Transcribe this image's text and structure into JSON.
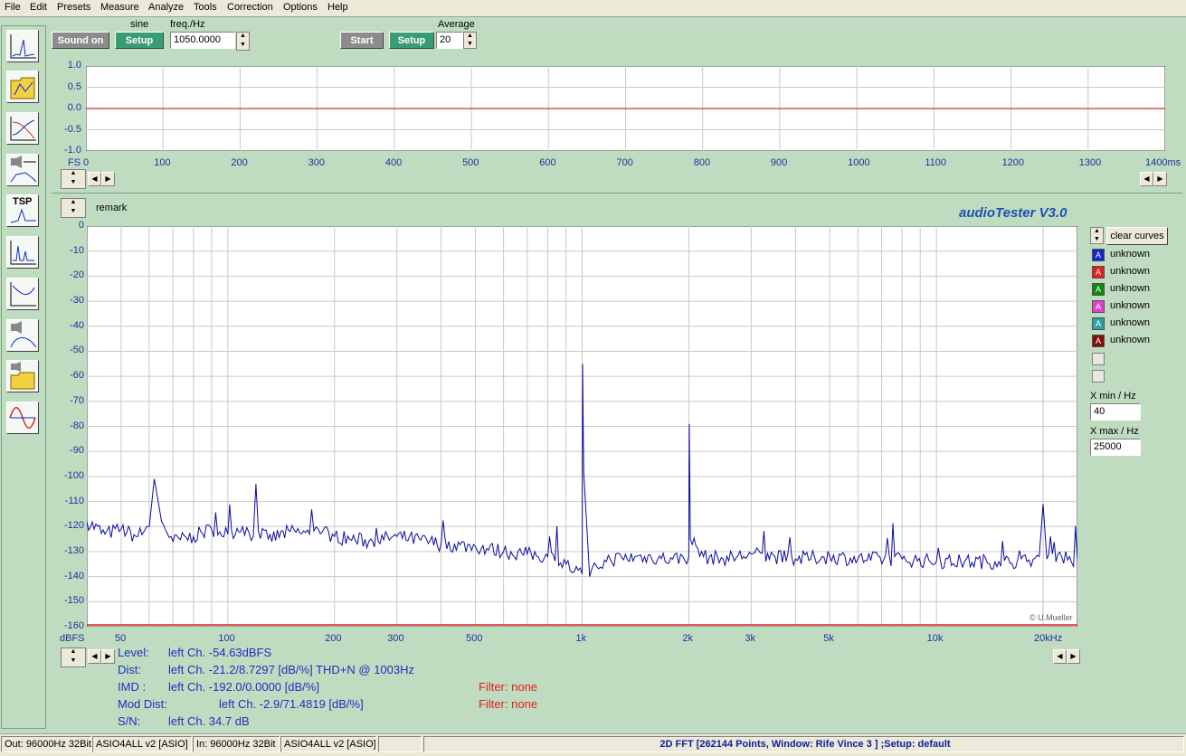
{
  "menu": [
    "File",
    "Edit",
    "Presets",
    "Measure",
    "Analyze",
    "Tools",
    "Correction",
    "Options",
    "Help"
  ],
  "toolbar": {
    "sound_on_label": "Sound on",
    "sine_label": "sine",
    "generator_setup_label": "Setup",
    "freq_label": "freq./Hz",
    "freq_value": "1050.0000",
    "start_label": "Start",
    "analyzer_setup_label": "Setup",
    "average_label": "Average",
    "average_value": "20"
  },
  "sidebar": {
    "tools": [
      "scope-fft-icon",
      "open-folder-icon",
      "bode-plot-icon",
      "speaker-response-icon",
      "tsp-icon",
      "fft-spectrum-icon",
      "frequency-response-icon",
      "speaker-rolloff-icon",
      "open-speaker-file-icon",
      "sine-wave-icon"
    ],
    "tsp_label": "TSP"
  },
  "scope": {
    "y_ticks": [
      "1.0",
      "0.5",
      "0.0",
      "-0.5",
      "-1.0"
    ],
    "x_prefix": "FS",
    "x_ticks": [
      "0",
      "100",
      "200",
      "300",
      "400",
      "500",
      "600",
      "700",
      "800",
      "900",
      "1000",
      "1100",
      "1200",
      "1300",
      "1400ms"
    ],
    "trace_color": "#c00000"
  },
  "spectrum": {
    "remark_label": "remark",
    "brand": "audioTester  V3.0",
    "watermark": "© U.Mueller",
    "y_unit": "dBFS",
    "x_unit": "kHz",
    "trace_color": "#0a0aa0"
  },
  "chart_data": {
    "type": "line",
    "title": "",
    "xlabel": "Hz",
    "ylabel": "dBFS",
    "x_scale": "log",
    "xlim": [
      40,
      25000
    ],
    "ylim": [
      -160,
      0
    ],
    "y_ticks": [
      "0",
      "-10",
      "-20",
      "-30",
      "-40",
      "-50",
      "-60",
      "-70",
      "-80",
      "-90",
      "-100",
      "-110",
      "-120",
      "-130",
      "-140",
      "-150",
      "-160"
    ],
    "x_tick_labels": [
      "50",
      "100",
      "200",
      "300",
      "500",
      "1k",
      "2k",
      "3k",
      "5k",
      "10k",
      "20kHz"
    ],
    "x_tick_values": [
      50,
      100,
      200,
      300,
      500,
      1000,
      2000,
      3000,
      5000,
      10000,
      20000
    ],
    "grid": true,
    "series": [
      {
        "x": [
          40,
          45,
          50,
          55,
          58,
          60,
          62,
          65,
          70,
          80,
          90,
          100,
          110,
          118,
          120,
          122,
          130,
          150,
          170,
          180,
          200,
          250,
          300,
          400,
          500,
          600,
          700,
          800,
          900,
          950,
          1000,
          1003,
          1010,
          1050,
          1100,
          1200,
          1500,
          1800,
          2000,
          2006,
          2020,
          2200,
          2500,
          3000,
          3500,
          4000,
          5000,
          6000,
          8000,
          10000,
          12000,
          15000,
          18000,
          19500,
          20000,
          20500,
          22000,
          25000
        ],
        "y": [
          -118,
          -123,
          -121,
          -124,
          -122,
          -120,
          -101,
          -118,
          -126,
          -124,
          -121,
          -123,
          -120,
          -124,
          -103,
          -122,
          -125,
          -122,
          -123,
          -121,
          -124,
          -126,
          -124,
          -127,
          -128,
          -130,
          -131,
          -132,
          -135,
          -138,
          -139,
          -55,
          -98,
          -140,
          -136,
          -133,
          -132,
          -133,
          -132,
          -79,
          -125,
          -132,
          -133,
          -131,
          -132,
          -133,
          -132,
          -133,
          -133,
          -134,
          -134,
          -134,
          -134,
          -132,
          -111,
          -133,
          -131,
          -134
        ]
      }
    ]
  },
  "legend": {
    "clear_label": "clear curves",
    "items": [
      {
        "label": "unknown",
        "color": "#1428c8",
        "mark": "A"
      },
      {
        "label": "unknown",
        "color": "#e02020",
        "mark": "A"
      },
      {
        "label": "unknown",
        "color": "#108810",
        "mark": "A"
      },
      {
        "label": "unknown",
        "color": "#e040d0",
        "mark": "A"
      },
      {
        "label": "unknown",
        "color": "#30a0a0",
        "mark": "A"
      },
      {
        "label": "unknown",
        "color": "#801010",
        "mark": "A"
      }
    ],
    "xmin_label": "X min / Hz",
    "xmin_value": "40",
    "xmax_label": "X max / Hz",
    "xmax_value": "25000"
  },
  "results": {
    "level_label": "Level:",
    "level_value": "left Ch. -54.63dBFS",
    "dist_label": "Dist:",
    "dist_value": "left Ch. -21.2/8.7297 [dB/%] THD+N  @ 1003Hz",
    "imd_label": "IMD  :",
    "imd_value": "left Ch. -192.0/0.0000 [dB/%]",
    "imd_filter": "Filter: none",
    "mod_label": "Mod Dist:",
    "mod_value": "left Ch. -2.9/71.4819 [dB/%]",
    "mod_filter": "Filter: none",
    "sn_label": "S/N:",
    "sn_value": "left Ch. 34.7 dB"
  },
  "status": {
    "out": "Out: 96000Hz 32Bit",
    "out_driver": "ASIO4ALL v2 [ASIO]",
    "in": "In: 96000Hz 32Bit",
    "in_driver": "ASIO4ALL v2 [ASIO]",
    "mode": "2D FFT [262144 Points, Window: Rife Vince 3 ] ;Setup:  default"
  }
}
